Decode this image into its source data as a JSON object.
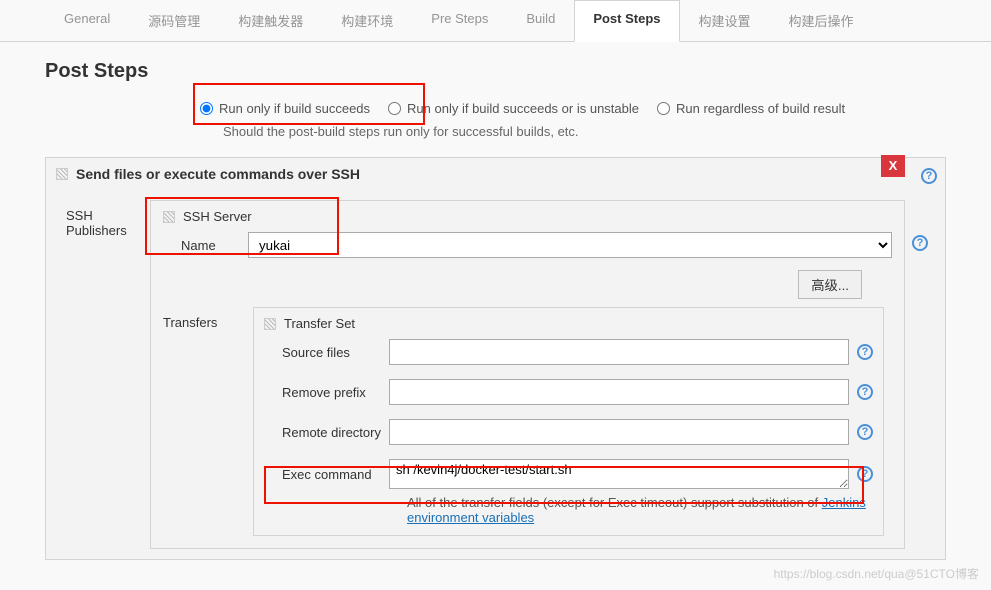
{
  "tabs": [
    {
      "label": "General"
    },
    {
      "label": "源码管理"
    },
    {
      "label": "构建触发器"
    },
    {
      "label": "构建环境"
    },
    {
      "label": "Pre Steps"
    },
    {
      "label": "Build"
    },
    {
      "label": "Post Steps",
      "active": true
    },
    {
      "label": "构建设置"
    },
    {
      "label": "构建后操作"
    }
  ],
  "page_title": "Post Steps",
  "radios": {
    "opt1": "Run only if build succeeds",
    "opt2": "Run only if build succeeds or is unstable",
    "opt3": "Run regardless of build result"
  },
  "radio_desc": "Should the post-build steps run only for successful builds, etc.",
  "section": {
    "title": "Send files or execute commands over SSH",
    "close": "X",
    "side_label": "SSH Publishers",
    "ssh_server_title": "SSH Server",
    "name_label": "Name",
    "name_value": "yukai",
    "advanced": "高级...",
    "transfers_label": "Transfers",
    "transfer_set_title": "Transfer Set",
    "fields": {
      "source_files": {
        "label": "Source files",
        "value": ""
      },
      "remove_prefix": {
        "label": "Remove prefix",
        "value": ""
      },
      "remote_directory": {
        "label": "Remote directory",
        "value": ""
      },
      "exec_command": {
        "label": "Exec command",
        "value": "sh /kevin4j/docker-test/start.sh"
      }
    },
    "note_pre": "All of the transfer fields (except for Exec timeout) support substitution of ",
    "note_link": "Jenkins environment variables"
  },
  "watermark": "https://blog.csdn.net/qua@51CTO博客"
}
